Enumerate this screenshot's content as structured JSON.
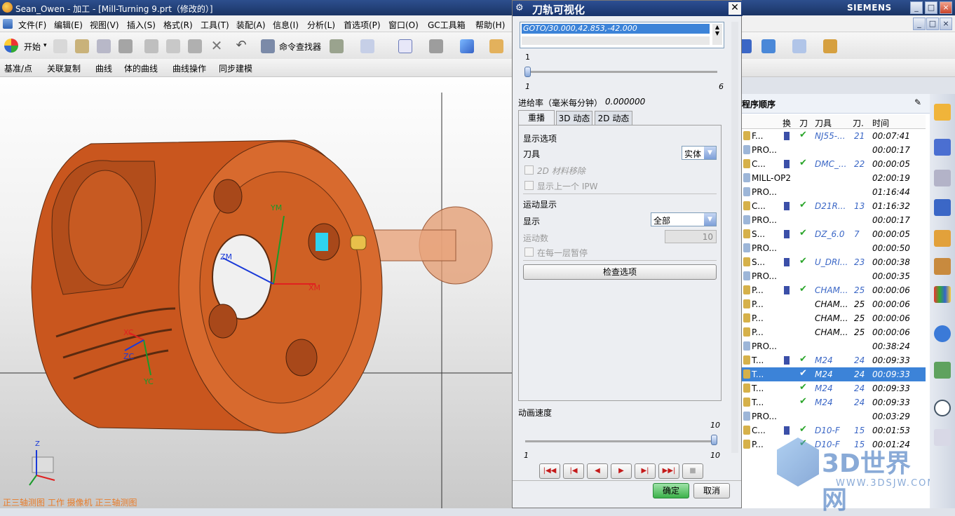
{
  "window": {
    "title": "Sean_Owen - 加工 - [Mill-Turning 9.prt（修改的）]",
    "brand": "SIEMENS",
    "controls": [
      "_",
      "□",
      "×"
    ]
  },
  "menu": [
    "文件(F)",
    "编辑(E)",
    "视图(V)",
    "插入(S)",
    "格式(R)",
    "工具(T)",
    "装配(A)",
    "信息(I)",
    "分析(L)",
    "首选项(P)",
    "窗口(O)",
    "GC工具箱",
    "帮助(H)"
  ],
  "toolbar": {
    "start_label": "开始",
    "command_finder_label": "命令查找器"
  },
  "toolbar2": [
    "基准/点",
    "关联复制",
    "曲线",
    "体的曲线",
    "曲线操作",
    "同步建模"
  ],
  "viewport": {
    "axis_labels": {
      "ym": "YM",
      "zm": "ZM",
      "xm": "XM",
      "yc": "YC",
      "zc": "ZC",
      "xc": "XC"
    },
    "triad_z": "Z",
    "status_text": "正三轴测图 工作 摄像机 正三轴测图"
  },
  "dialog": {
    "title": "刀轨可视化",
    "list_item": "GOTO/30.000,42.853,-42.000",
    "slider_top": {
      "value": "1",
      "min": "1",
      "max": "6"
    },
    "feed_label": "进给率（毫米每分钟）",
    "feed_value": "0.000000",
    "tabs": [
      "重播",
      "3D 动态",
      "2D 动态"
    ],
    "display_options_label": "显示选项",
    "tool_label": "刀具",
    "tool_value": "实体",
    "material_removal_label": "2D 材料移除",
    "show_prev_ipw_label": "显示上一个 IPW",
    "motion_display_label": "运动显示",
    "display_label": "显示",
    "display_value": "全部",
    "motion_count_label": "运动数",
    "motion_count_value": "10",
    "pause_each_layer_label": "在每一层暂停",
    "check_options_label": "检查选项",
    "anim_speed_label": "动画速度",
    "speed_value": "10",
    "speed_min": "1",
    "speed_max": "10",
    "ok_label": "确定",
    "cancel_label": "取消"
  },
  "nav": {
    "title": "程序顺序",
    "columns": [
      "换",
      "刀",
      "刀具",
      "刀.",
      "时间"
    ],
    "rows": [
      {
        "name": "F...",
        "tool": "NJ55-...",
        "num": "21",
        "time": "00:07:41",
        "check": true,
        "swap": true
      },
      {
        "name": "PRO...",
        "tool": "",
        "num": "",
        "time": "00:00:17",
        "check": false,
        "swap": false
      },
      {
        "name": "C...",
        "tool": "DMC_...",
        "num": "22",
        "time": "00:00:05",
        "check": true,
        "swap": true
      },
      {
        "name": "MILL-OP2",
        "tool": "",
        "num": "",
        "time": "02:00:19",
        "check": false,
        "swap": false
      },
      {
        "name": "PRO...",
        "tool": "",
        "num": "",
        "time": "01:16:44",
        "check": false,
        "swap": false
      },
      {
        "name": "C...",
        "tool": "D21R...",
        "num": "13",
        "time": "01:16:32",
        "check": true,
        "swap": true
      },
      {
        "name": "PRO...",
        "tool": "",
        "num": "",
        "time": "00:00:17",
        "check": false,
        "swap": false
      },
      {
        "name": "S...",
        "tool": "DZ_6.0",
        "num": "7",
        "time": "00:00:05",
        "check": true,
        "swap": true
      },
      {
        "name": "PRO...",
        "tool": "",
        "num": "",
        "time": "00:00:50",
        "check": false,
        "swap": false
      },
      {
        "name": "S...",
        "tool": "U_DRI...",
        "num": "23",
        "time": "00:00:38",
        "check": true,
        "swap": true
      },
      {
        "name": "PRO...",
        "tool": "",
        "num": "",
        "time": "00:00:35",
        "check": false,
        "swap": false
      },
      {
        "name": "P...",
        "tool": "CHAM...",
        "num": "25",
        "time": "00:00:06",
        "check": true,
        "swap": true
      },
      {
        "name": "P...",
        "tool": "CHAM...",
        "num": "25",
        "time": "00:00:06",
        "check": false,
        "swap": false
      },
      {
        "name": "P...",
        "tool": "CHAM...",
        "num": "25",
        "time": "00:00:06",
        "check": false,
        "swap": false
      },
      {
        "name": "P...",
        "tool": "CHAM...",
        "num": "25",
        "time": "00:00:06",
        "check": false,
        "swap": false
      },
      {
        "name": "PRO...",
        "tool": "",
        "num": "",
        "time": "00:38:24",
        "check": false,
        "swap": false
      },
      {
        "name": "T...",
        "tool": "M24",
        "num": "24",
        "time": "00:09:33",
        "check": true,
        "swap": true
      },
      {
        "name": "T...",
        "tool": "M24",
        "num": "24",
        "time": "00:09:33",
        "check": true,
        "swap": false
      },
      {
        "name": "T...",
        "tool": "M24",
        "num": "24",
        "time": "00:09:33",
        "check": true,
        "swap": false
      },
      {
        "name": "T...",
        "tool": "M24",
        "num": "24",
        "time": "00:09:33",
        "check": true,
        "swap": false
      },
      {
        "name": "PRO...",
        "tool": "",
        "num": "",
        "time": "00:03:29",
        "check": false,
        "swap": false
      },
      {
        "name": "C...",
        "tool": "D10-F",
        "num": "15",
        "time": "00:01:53",
        "check": true,
        "swap": true
      },
      {
        "name": "P...",
        "tool": "D10-F",
        "num": "15",
        "time": "00:01:24",
        "check": true,
        "swap": false
      }
    ]
  },
  "watermark": {
    "text": "3D世界网",
    "url": "WWW.3DSJW.COM"
  }
}
